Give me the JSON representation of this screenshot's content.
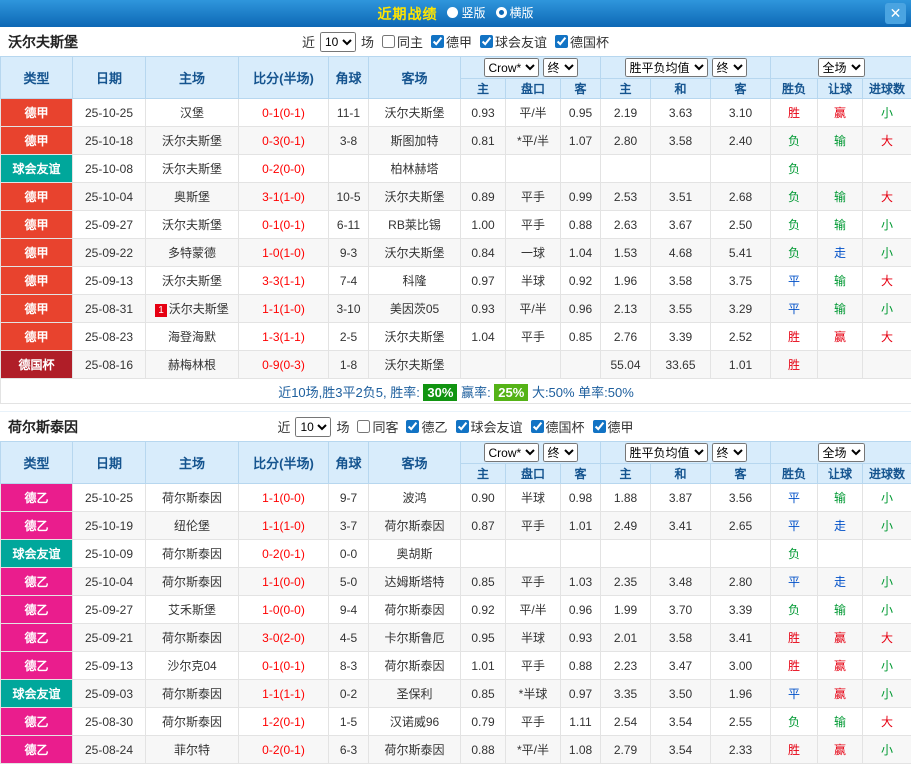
{
  "titlebar": {
    "title": "近期战绩",
    "radios": [
      {
        "label": "竖版",
        "selected": false
      },
      {
        "label": "横版",
        "selected": true
      }
    ],
    "close_label": "✕"
  },
  "league_colors": {
    "德甲": "#e8432e",
    "德乙": "#ea1d8d",
    "球会友谊": "#00a79b",
    "德国杯": "#b01e28"
  },
  "result_colors": {
    "胜": "#e60012",
    "平": "#0050c8",
    "负": "#009933",
    "赢": "#e60012",
    "走": "#0050c8",
    "输": "#009933",
    "大": "#e60012",
    "小": "#009933"
  },
  "sections": [
    {
      "team": "沃尔夫斯堡",
      "filter": {
        "near_label": "近",
        "count": "10",
        "games_label": "场",
        "checkboxes": [
          {
            "label": "同主",
            "checked": false
          },
          {
            "label": "德甲",
            "checked": true
          },
          {
            "label": "球会友谊",
            "checked": true
          },
          {
            "label": "德国杯",
            "checked": true
          }
        ]
      },
      "header": {
        "base_cols": [
          "类型",
          "日期",
          "主场",
          "比分(半场)",
          "角球",
          "客场"
        ],
        "asia_select": "Crow*",
        "asia_final": "终",
        "asia_cols": [
          "主",
          "盘口",
          "客"
        ],
        "euro_select": "胜平负均值",
        "euro_final": "终",
        "euro_cols": [
          "主",
          "和",
          "客"
        ],
        "res_select": "全场",
        "res_cols": [
          "胜负",
          "让球",
          "进球数"
        ]
      },
      "rows": [
        {
          "league": "德甲",
          "date": "25-10-25",
          "home": "汉堡",
          "home_hl": false,
          "home_badge": "",
          "score": "0-1(0-1)",
          "corner": "11-1",
          "away": "沃尔夫斯堡",
          "away_hl": true,
          "asia": [
            "0.93",
            "平/半",
            "0.95"
          ],
          "euro": [
            "2.19",
            "3.63",
            "3.10"
          ],
          "res": [
            "胜",
            "赢",
            "小"
          ]
        },
        {
          "league": "德甲",
          "date": "25-10-18",
          "home": "沃尔夫斯堡",
          "home_hl": true,
          "home_badge": "",
          "score": "0-3(0-1)",
          "corner": "3-8",
          "away": "斯图加特",
          "away_hl": false,
          "asia": [
            "0.81",
            "*平/半",
            "1.07"
          ],
          "euro": [
            "2.80",
            "3.58",
            "2.40"
          ],
          "res": [
            "负",
            "输",
            "大"
          ]
        },
        {
          "league": "球会友谊",
          "date": "25-10-08",
          "home": "沃尔夫斯堡",
          "home_hl": true,
          "home_badge": "",
          "score": "0-2(0-0)",
          "corner": "",
          "away": "柏林赫塔",
          "away_hl": false,
          "asia": [
            "",
            "",
            ""
          ],
          "euro": [
            "",
            "",
            ""
          ],
          "res": [
            "负",
            "",
            ""
          ]
        },
        {
          "league": "德甲",
          "date": "25-10-04",
          "home": "奥斯堡",
          "home_hl": false,
          "home_badge": "",
          "score": "3-1(1-0)",
          "corner": "10-5",
          "away": "沃尔夫斯堡",
          "away_hl": true,
          "asia": [
            "0.89",
            "平手",
            "0.99"
          ],
          "euro": [
            "2.53",
            "3.51",
            "2.68"
          ],
          "res": [
            "负",
            "输",
            "大"
          ]
        },
        {
          "league": "德甲",
          "date": "25-09-27",
          "home": "沃尔夫斯堡",
          "home_hl": true,
          "home_badge": "",
          "score": "0-1(0-1)",
          "corner": "6-11",
          "away": "RB莱比锡",
          "away_hl": false,
          "asia": [
            "1.00",
            "平手",
            "0.88"
          ],
          "euro": [
            "2.63",
            "3.67",
            "2.50"
          ],
          "res": [
            "负",
            "输",
            "小"
          ]
        },
        {
          "league": "德甲",
          "date": "25-09-22",
          "home": "多特蒙德",
          "home_hl": false,
          "home_badge": "",
          "score": "1-0(1-0)",
          "corner": "9-3",
          "away": "沃尔夫斯堡",
          "away_hl": true,
          "asia": [
            "0.84",
            "一球",
            "1.04"
          ],
          "euro": [
            "1.53",
            "4.68",
            "5.41"
          ],
          "res": [
            "负",
            "走",
            "小"
          ]
        },
        {
          "league": "德甲",
          "date": "25-09-13",
          "home": "沃尔夫斯堡",
          "home_hl": true,
          "home_badge": "",
          "score": "3-3(1-1)",
          "corner": "7-4",
          "away": "科隆",
          "away_hl": false,
          "asia": [
            "0.97",
            "半球",
            "0.92"
          ],
          "euro": [
            "1.96",
            "3.58",
            "3.75"
          ],
          "res": [
            "平",
            "输",
            "大"
          ]
        },
        {
          "league": "德甲",
          "date": "25-08-31",
          "home": "沃尔夫斯堡",
          "home_hl": true,
          "home_badge": "1",
          "score": "1-1(1-0)",
          "corner": "3-10",
          "away": "美因茨05",
          "away_hl": false,
          "asia": [
            "0.93",
            "平/半",
            "0.96"
          ],
          "euro": [
            "2.13",
            "3.55",
            "3.29"
          ],
          "res": [
            "平",
            "输",
            "小"
          ]
        },
        {
          "league": "德甲",
          "date": "25-08-23",
          "home": "海登海默",
          "home_hl": false,
          "home_badge": "",
          "score": "1-3(1-1)",
          "corner": "2-5",
          "away": "沃尔夫斯堡",
          "away_hl": true,
          "asia": [
            "1.04",
            "平手",
            "0.85"
          ],
          "euro": [
            "2.76",
            "3.39",
            "2.52"
          ],
          "res": [
            "胜",
            "赢",
            "大"
          ]
        },
        {
          "league": "德国杯",
          "date": "25-08-16",
          "home": "赫梅林根",
          "home_hl": false,
          "home_badge": "",
          "score": "0-9(0-3)",
          "corner": "1-8",
          "away": "沃尔夫斯堡",
          "away_hl": true,
          "asia": [
            "",
            "",
            ""
          ],
          "euro": [
            "55.04",
            "33.65",
            "1.01"
          ],
          "res": [
            "胜",
            "",
            ""
          ]
        }
      ],
      "summary": {
        "prefix": "近10场,胜3平2负5, 胜率:",
        "win_rate": "30%",
        "mid": "赢率:",
        "profit_rate": "25%",
        "tail": "大:50% 单率:50%"
      }
    },
    {
      "team": "荷尔斯泰因",
      "filter": {
        "near_label": "近",
        "count": "10",
        "games_label": "场",
        "checkboxes": [
          {
            "label": "同客",
            "checked": false
          },
          {
            "label": "德乙",
            "checked": true
          },
          {
            "label": "球会友谊",
            "checked": true
          },
          {
            "label": "德国杯",
            "checked": true
          },
          {
            "label": "德甲",
            "checked": true
          }
        ]
      },
      "header": {
        "base_cols": [
          "类型",
          "日期",
          "主场",
          "比分(半场)",
          "角球",
          "客场"
        ],
        "asia_select": "Crow*",
        "asia_final": "终",
        "asia_cols": [
          "主",
          "盘口",
          "客"
        ],
        "euro_select": "胜平负均值",
        "euro_final": "终",
        "euro_cols": [
          "主",
          "和",
          "客"
        ],
        "res_select": "全场",
        "res_cols": [
          "胜负",
          "让球",
          "进球数"
        ]
      },
      "rows": [
        {
          "league": "德乙",
          "date": "25-10-25",
          "home": "荷尔斯泰因",
          "home_hl": true,
          "home_badge": "",
          "score": "1-1(0-0)",
          "corner": "9-7",
          "away": "波鸿",
          "away_hl": false,
          "asia": [
            "0.90",
            "半球",
            "0.98"
          ],
          "euro": [
            "1.88",
            "3.87",
            "3.56"
          ],
          "res": [
            "平",
            "输",
            "小"
          ]
        },
        {
          "league": "德乙",
          "date": "25-10-19",
          "home": "纽伦堡",
          "home_hl": false,
          "home_badge": "",
          "score": "1-1(1-0)",
          "corner": "3-7",
          "away": "荷尔斯泰因",
          "away_hl": true,
          "asia": [
            "0.87",
            "平手",
            "1.01"
          ],
          "euro": [
            "2.49",
            "3.41",
            "2.65"
          ],
          "res": [
            "平",
            "走",
            "小"
          ]
        },
        {
          "league": "球会友谊",
          "date": "25-10-09",
          "home": "荷尔斯泰因",
          "home_hl": true,
          "home_badge": "",
          "score": "0-2(0-1)",
          "corner": "0-0",
          "away": "奥胡斯",
          "away_hl": false,
          "asia": [
            "",
            "",
            ""
          ],
          "euro": [
            "",
            "",
            ""
          ],
          "res": [
            "负",
            "",
            ""
          ]
        },
        {
          "league": "德乙",
          "date": "25-10-04",
          "home": "荷尔斯泰因",
          "home_hl": true,
          "home_badge": "",
          "score": "1-1(0-0)",
          "corner": "5-0",
          "away": "达姆斯塔特",
          "away_hl": false,
          "asia": [
            "0.85",
            "平手",
            "1.03"
          ],
          "euro": [
            "2.35",
            "3.48",
            "2.80"
          ],
          "res": [
            "平",
            "走",
            "小"
          ]
        },
        {
          "league": "德乙",
          "date": "25-09-27",
          "home": "艾禾斯堡",
          "home_hl": false,
          "home_badge": "",
          "score": "1-0(0-0)",
          "corner": "9-4",
          "away": "荷尔斯泰因",
          "away_hl": true,
          "asia": [
            "0.92",
            "平/半",
            "0.96"
          ],
          "euro": [
            "1.99",
            "3.70",
            "3.39"
          ],
          "res": [
            "负",
            "输",
            "小"
          ]
        },
        {
          "league": "德乙",
          "date": "25-09-21",
          "home": "荷尔斯泰因",
          "home_hl": true,
          "home_badge": "",
          "score": "3-0(2-0)",
          "corner": "4-5",
          "away": "卡尔斯鲁厄",
          "away_hl": false,
          "asia": [
            "0.95",
            "半球",
            "0.93"
          ],
          "euro": [
            "2.01",
            "3.58",
            "3.41"
          ],
          "res": [
            "胜",
            "赢",
            "大"
          ]
        },
        {
          "league": "德乙",
          "date": "25-09-13",
          "home": "沙尔克04",
          "home_hl": false,
          "home_badge": "",
          "score": "0-1(0-1)",
          "corner": "8-3",
          "away": "荷尔斯泰因",
          "away_hl": true,
          "asia": [
            "1.01",
            "平手",
            "0.88"
          ],
          "euro": [
            "2.23",
            "3.47",
            "3.00"
          ],
          "res": [
            "胜",
            "赢",
            "小"
          ]
        },
        {
          "league": "球会友谊",
          "date": "25-09-03",
          "home": "荷尔斯泰因",
          "home_hl": true,
          "home_badge": "",
          "score": "1-1(1-1)",
          "corner": "0-2",
          "away": "圣保利",
          "away_hl": false,
          "asia": [
            "0.85",
            "*半球",
            "0.97"
          ],
          "euro": [
            "3.35",
            "3.50",
            "1.96"
          ],
          "res": [
            "平",
            "赢",
            "小"
          ]
        },
        {
          "league": "德乙",
          "date": "25-08-30",
          "home": "荷尔斯泰因",
          "home_hl": true,
          "home_badge": "",
          "score": "1-2(0-1)",
          "corner": "1-5",
          "away": "汉诺威96",
          "away_hl": false,
          "asia": [
            "0.79",
            "平手",
            "1.11"
          ],
          "euro": [
            "2.54",
            "3.54",
            "2.55"
          ],
          "res": [
            "负",
            "输",
            "大"
          ]
        },
        {
          "league": "德乙",
          "date": "25-08-24",
          "home": "菲尔特",
          "home_hl": false,
          "home_badge": "",
          "score": "0-2(0-1)",
          "corner": "6-3",
          "away": "荷尔斯泰因",
          "away_hl": true,
          "asia": [
            "0.88",
            "*平/半",
            "1.08"
          ],
          "euro": [
            "2.79",
            "3.54",
            "2.33"
          ],
          "res": [
            "胜",
            "赢",
            "小"
          ]
        }
      ],
      "summary": null
    }
  ]
}
